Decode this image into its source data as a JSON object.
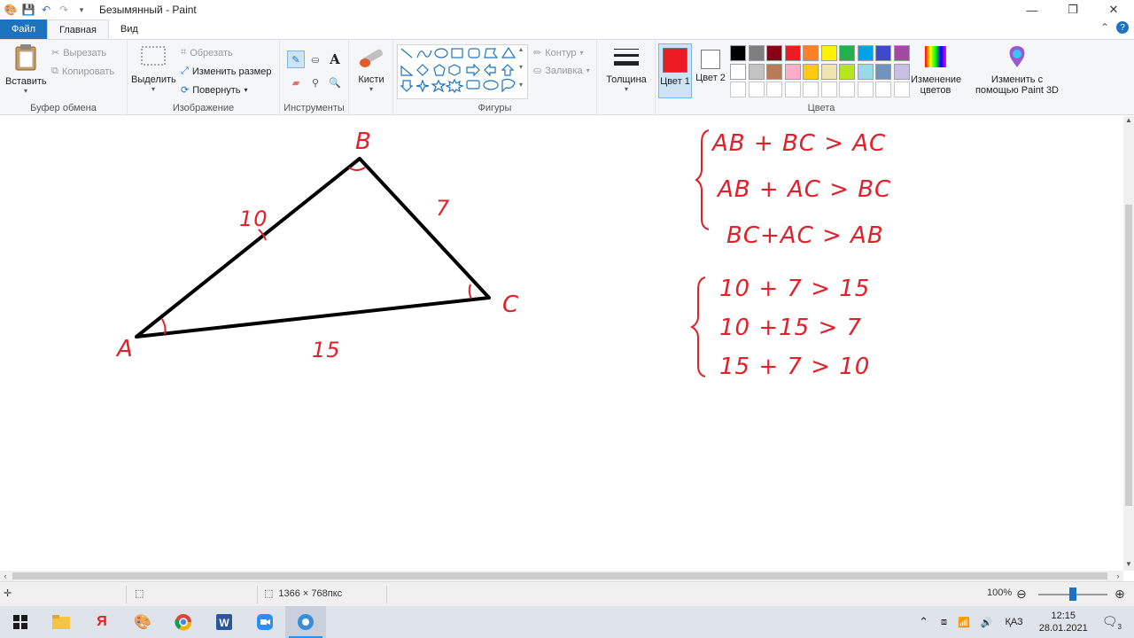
{
  "window": {
    "title": "Безымянный - Paint"
  },
  "tabs": [
    "Файл",
    "Главная",
    "Вид"
  ],
  "clipboard": {
    "paste": "Вставить",
    "cut": "Вырезать",
    "copy": "Копировать",
    "group": "Буфер обмена"
  },
  "image": {
    "select": "Выделить",
    "crop": "Обрезать",
    "resize": "Изменить размер",
    "rotate": "Повернуть",
    "group": "Изображение"
  },
  "tools": {
    "group": "Инструменты"
  },
  "brushes": {
    "label": "Кисти"
  },
  "shapes": {
    "outline": "Контур",
    "fill": "Заливка",
    "group": "Фигуры"
  },
  "thickness": {
    "label": "Толщина"
  },
  "colors": {
    "color1": "Цвет 1",
    "color2": "Цвет 2",
    "edit": "Изменение цветов",
    "paint3d": "Изменить с помощью Paint 3D",
    "group": "Цвета",
    "color1_value": "#ed1c24",
    "color2_value": "#ffffff",
    "palette_row1": [
      "#000000",
      "#7f7f7f",
      "#880015",
      "#ed1c24",
      "#ff7f27",
      "#fff200",
      "#22b14c",
      "#00a2e8",
      "#3f48cc",
      "#a349a4"
    ],
    "palette_row2": [
      "#ffffff",
      "#c3c3c3",
      "#b97a57",
      "#ffaec9",
      "#ffc90e",
      "#efe4b0",
      "#b5e61d",
      "#99d9ea",
      "#7092be",
      "#c8bfe7"
    ],
    "palette_row3": [
      "#ffffff",
      "#ffffff",
      "#ffffff",
      "#ffffff",
      "#ffffff",
      "#ffffff",
      "#ffffff",
      "#ffffff",
      "#ffffff",
      "#ffffff"
    ]
  },
  "drawing": {
    "vertex_a": "A",
    "vertex_b": "B",
    "vertex_c": "C",
    "side_ab": "10",
    "side_bc": "7",
    "side_ac": "15",
    "system1": [
      "AB + BC > AC",
      "AB + AC > BC",
      "BC+AC > AB"
    ],
    "system2": [
      "10 + 7 > 15",
      "10 +15 > 7",
      "15 + 7 > 10"
    ],
    "ink_color": "#e0202a"
  },
  "status": {
    "dimensions": "1366 × 768пкс",
    "zoom": "100%"
  },
  "taskbar": {
    "lang": "ҚАЗ",
    "time": "12:15",
    "date": "28.01.2021",
    "notifications": "3"
  }
}
